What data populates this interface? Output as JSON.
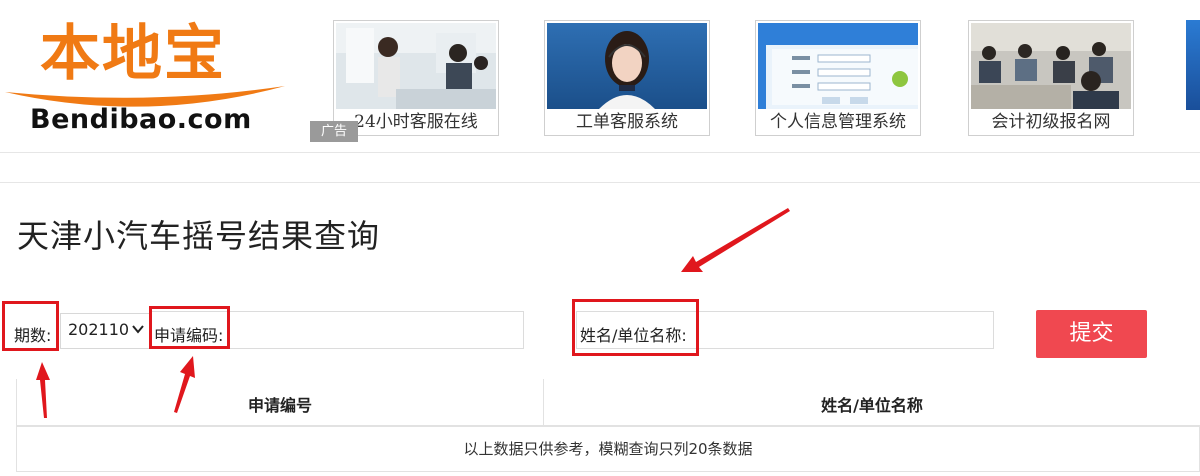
{
  "logo": {
    "cn_text": "本地宝",
    "en_text": "Bendibao.com",
    "brand_color": "#f07a14"
  },
  "ads": {
    "tag": "广告",
    "items": [
      {
        "caption": "24小时客服在线",
        "image": "office-workers-photo"
      },
      {
        "caption": "工单客服系统",
        "image": "customer-service-headset-photo"
      },
      {
        "caption": "个人信息管理系统",
        "image": "login-form-screenshot"
      },
      {
        "caption": "会计初级报名网",
        "image": "exam-classroom-photo"
      }
    ]
  },
  "page": {
    "title": "天津小汽车摇号结果查询"
  },
  "form": {
    "period_label": "期数:",
    "period_value": "202110",
    "apply_code_label": "申请编码:",
    "apply_code_value": "",
    "name_label": "姓名/单位名称:",
    "name_value": "",
    "submit_label": "提交",
    "submit_color": "#f04850"
  },
  "table": {
    "headers": [
      "申请编号",
      "姓名/单位名称"
    ],
    "note": "以上数据只供参考，模糊查询只列20条数据"
  },
  "annotation": {
    "color": "#e0171d"
  }
}
